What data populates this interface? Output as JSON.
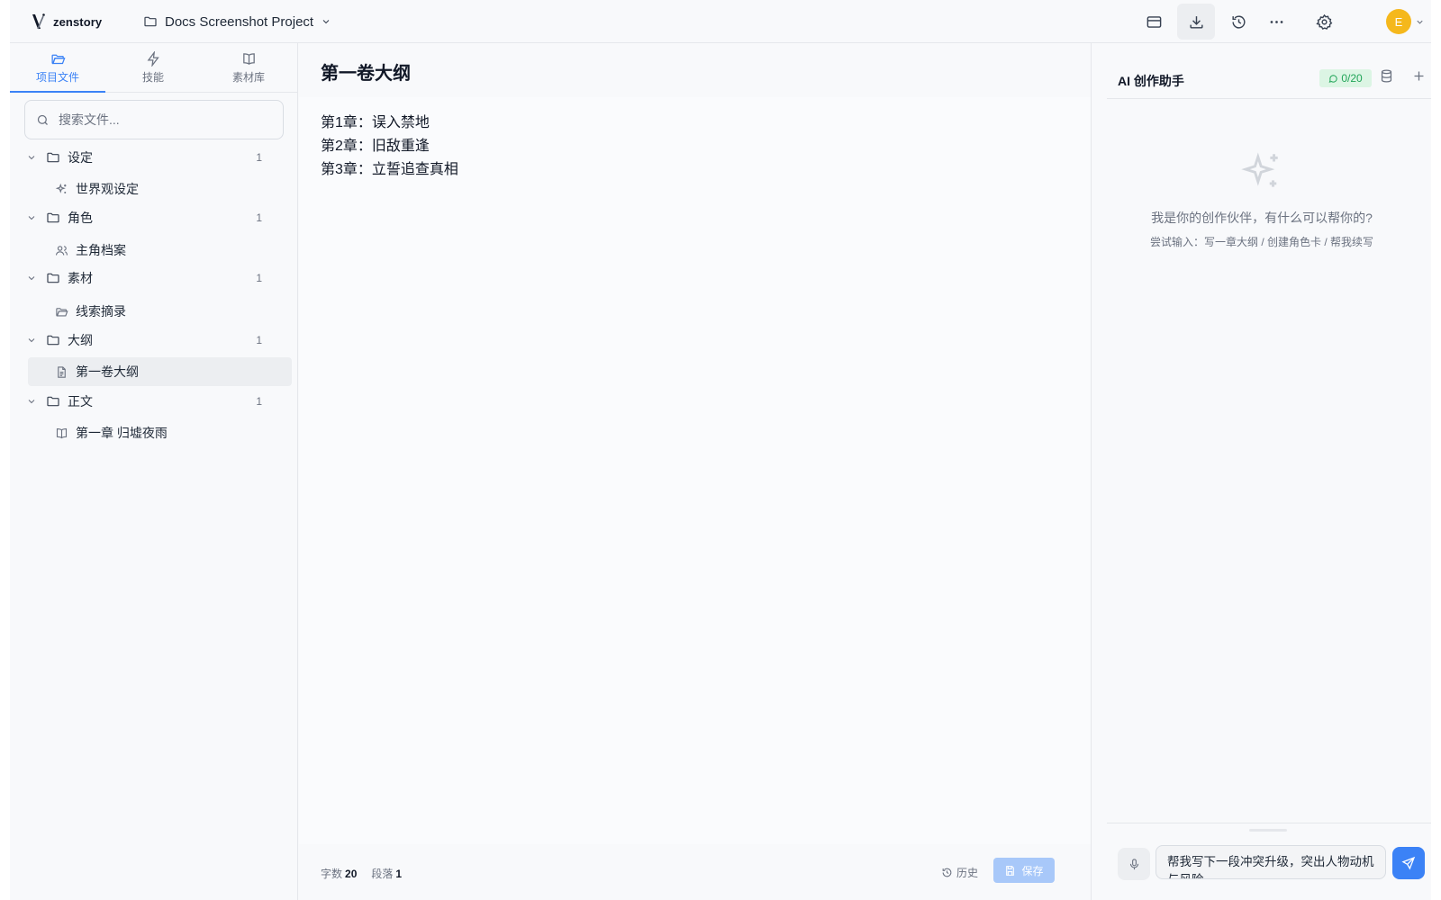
{
  "app": {
    "brand": "zenstory",
    "project_name": "Docs Screenshot Project"
  },
  "toolbar": {
    "icons": [
      "panel-icon",
      "download-icon",
      "history-icon",
      "more-icon",
      "settings-icon"
    ],
    "avatar_letter": "E",
    "avatar_color": "#f5b81c"
  },
  "sidebar": {
    "tabs": [
      {
        "label": "项目文件",
        "icon": "folder-open-icon",
        "active": true
      },
      {
        "label": "技能",
        "icon": "lightning-icon",
        "active": false
      },
      {
        "label": "素材库",
        "icon": "book-icon",
        "active": false
      }
    ],
    "search_placeholder": "搜索文件...",
    "folders": [
      {
        "name": "设定",
        "count": "1",
        "child": {
          "name": "世界观设定",
          "icon": "sparkles-icon"
        }
      },
      {
        "name": "角色",
        "count": "1",
        "child": {
          "name": "主角档案",
          "icon": "users-icon"
        }
      },
      {
        "name": "素材",
        "count": "1",
        "child": {
          "name": "线索摘录",
          "icon": "folder-open-icon"
        }
      },
      {
        "name": "大纲",
        "count": "1",
        "child": {
          "name": "第一卷大纲",
          "icon": "document-icon",
          "selected": true
        }
      },
      {
        "name": "正文",
        "count": "1",
        "child": {
          "name": "第一章 归墟夜雨",
          "icon": "book-icon"
        }
      }
    ]
  },
  "editor": {
    "title": "第一卷大纲",
    "lines": [
      "第1章：误入禁地",
      "第2章：旧敌重逢",
      "第3章：立誓追查真相"
    ],
    "status": {
      "word_label": "字数",
      "word_count": "20",
      "para_label": "段落",
      "para_count": "1",
      "history_label": "历史",
      "save_label": "保存"
    }
  },
  "ai": {
    "title": "AI 创作助手",
    "quota": "0/20",
    "empty_message": "我是你的创作伙伴，有什么可以帮你的?",
    "empty_hint": "尝试输入：写一章大纲 / 创建角色卡 / 帮我续写",
    "input_value": "帮我写下一段冲突升级，突出人物动机与风险"
  },
  "colors": {
    "accent": "#3b82f6",
    "quota_green": "#22a559",
    "save_disabled": "#a8c8f9"
  }
}
